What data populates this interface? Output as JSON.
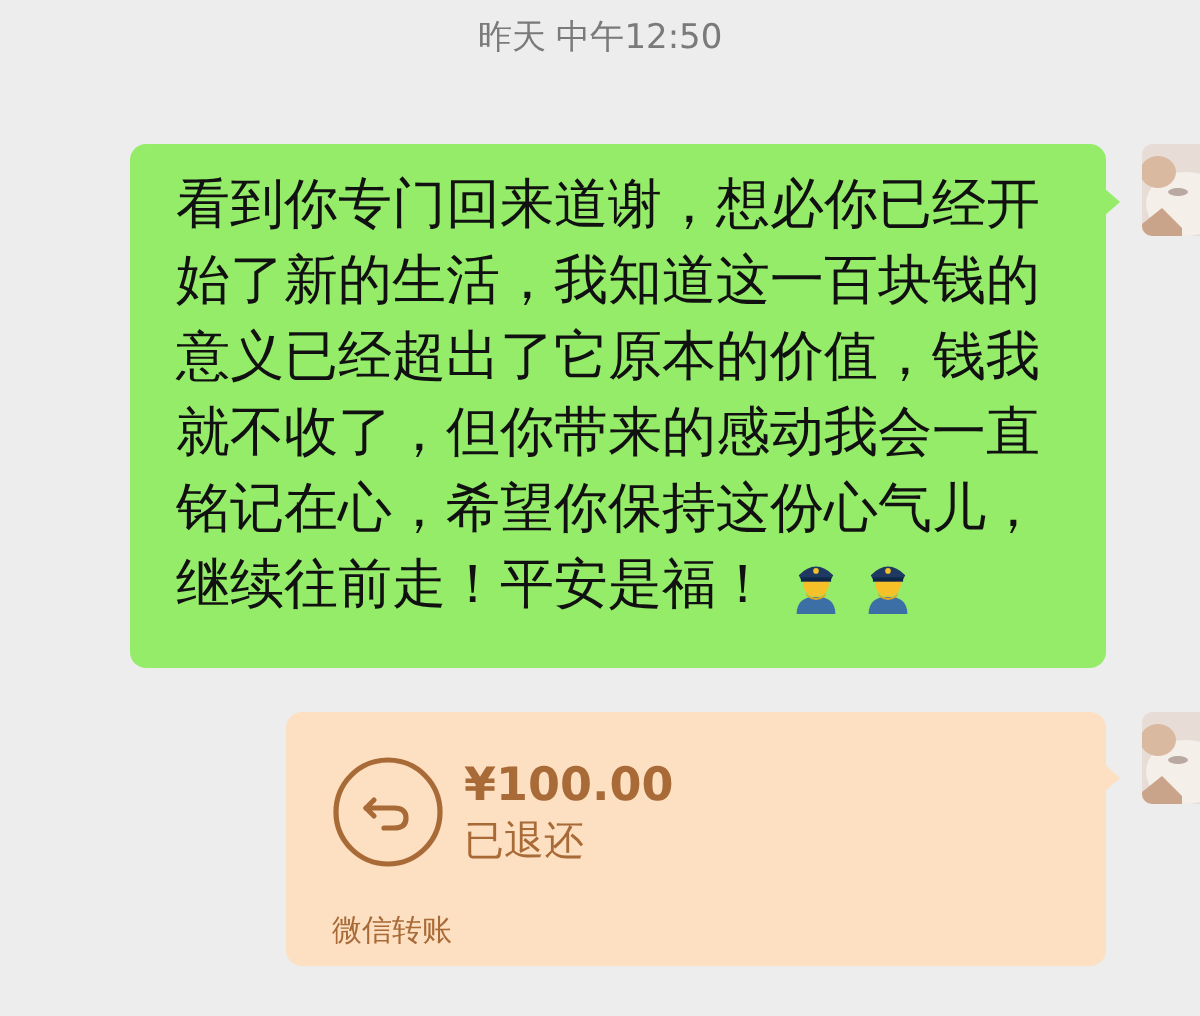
{
  "timestamp": "昨天 中午12:50",
  "messages": [
    {
      "kind": "text",
      "lines": [
        "看到你专门回来道谢，想必你已经开",
        "始了新的生活，我知道这一百块钱的",
        "意义已经超出了它原本的价值，钱我",
        "就不收了，但你带来的感动我会一直",
        "铭记在心，希望你保持这份心气儿，",
        "继续往前走！平安是福！"
      ],
      "emojis": [
        {
          "kind": "police-officer"
        },
        {
          "kind": "police-officer"
        }
      ]
    },
    {
      "kind": "transfer",
      "amount": "¥100.00",
      "status": "已退还",
      "footer": "微信转账"
    }
  ]
}
